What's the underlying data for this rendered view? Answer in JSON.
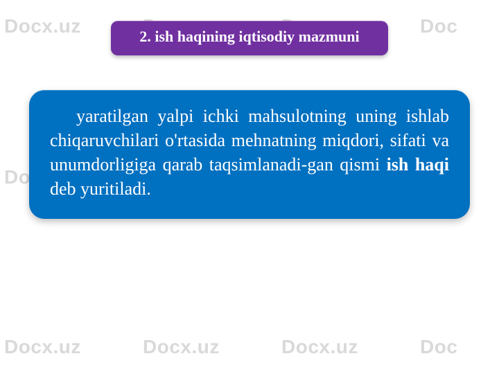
{
  "watermark": {
    "text": "Docx.uz",
    "partial": "Doc"
  },
  "title": "2. ish haqining iqtisodiy mazmuni",
  "body": {
    "pre": "yaratilgan yalpi ichki mahsulotning uning ishlab chiqaruvchilari o'rtasida mehnatning miqdori, sifati va unumdorligiga qarab taqsimlanadi-gan qismi ",
    "bold": "ish haqi",
    "post": " deb yuritiladi."
  }
}
